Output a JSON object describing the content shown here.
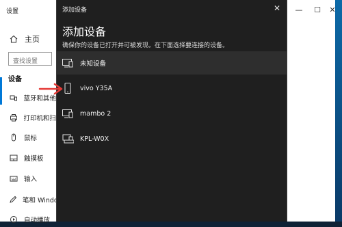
{
  "settings_window": {
    "title": "设置",
    "controls": {
      "minimize": "—",
      "maximize": "☐",
      "close": "✕"
    },
    "nav_home": "主页",
    "search_placeholder": "查找设置",
    "section": "设备",
    "nav_items": [
      {
        "label": "蓝牙和其他",
        "icon": "bluetooth-icon"
      },
      {
        "label": "打印机和扫",
        "icon": "printer-icon"
      },
      {
        "label": "鼠标",
        "icon": "mouse-icon"
      },
      {
        "label": "触摸板",
        "icon": "touchpad-icon"
      },
      {
        "label": "输入",
        "icon": "keyboard-icon"
      },
      {
        "label": "笔和 Windo",
        "icon": "pen-icon"
      },
      {
        "label": "自动播放",
        "icon": "autoplay-icon"
      }
    ]
  },
  "dialog": {
    "title": "添加设备",
    "heading": "添加设备",
    "subtitle": "确保你的设备已打开并可被发现。在下面选择要连接的设备。",
    "close_label": "✕",
    "devices": [
      {
        "name": "未知设备",
        "icon": "computer-icon"
      },
      {
        "name": "vivo Y35A",
        "icon": "phone-icon"
      },
      {
        "name": "mambo 2",
        "icon": "computer-icon"
      },
      {
        "name": "KPL-W0X",
        "icon": "desktop-icon"
      }
    ]
  },
  "colors": {
    "accent": "#0078d7",
    "dialog_bg": "#1f1f1f",
    "arrow": "#e53935"
  }
}
